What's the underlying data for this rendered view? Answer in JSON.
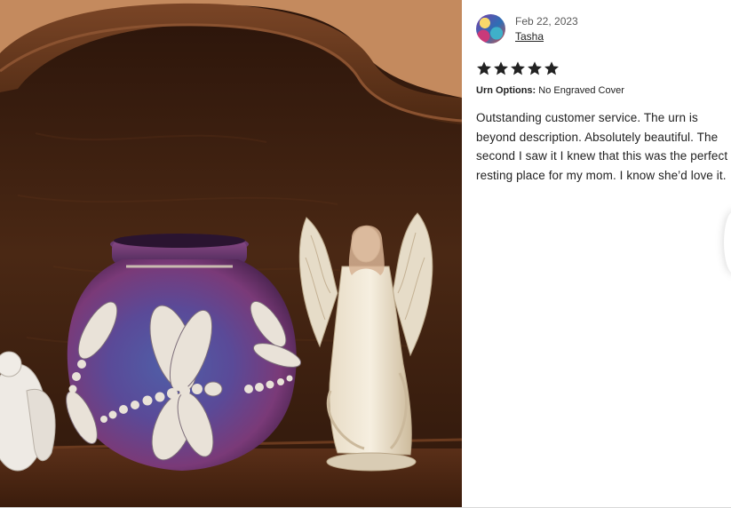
{
  "photo": {
    "alt_icon": "review-photo"
  },
  "review": {
    "date": "Feb 22, 2023",
    "reviewer": "Tasha",
    "rating": 5,
    "rating_max": 5,
    "options": {
      "label": "Urn Options:",
      "value": "No Engraved Cover"
    },
    "text": "Outstanding customer service. The urn is beyond description. Absolutely beautiful. The second I saw it I knew that this was the perfect resting place for my mom. I know she’d love it."
  },
  "colors": {
    "star": "#222222",
    "text": "#222222",
    "muted": "#595959",
    "wood_dark": "#3a1f10",
    "urn_purple": "#5a3a7a"
  }
}
